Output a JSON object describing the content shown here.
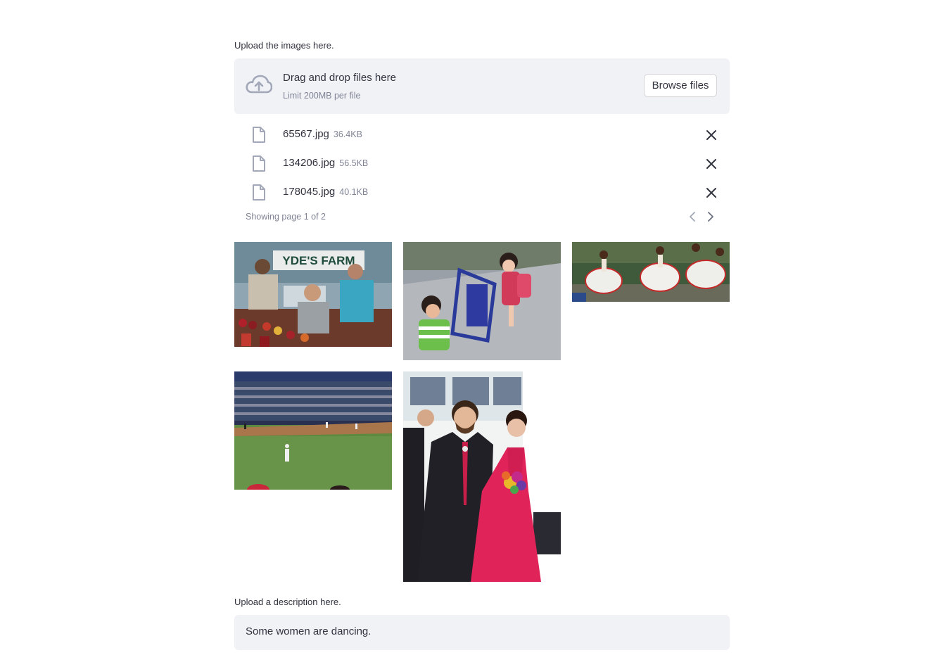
{
  "uploader": {
    "label": "Upload the images here.",
    "dropzone_title": "Drag and drop files here",
    "dropzone_limit": "Limit 200MB per file",
    "browse_label": "Browse files",
    "upload_icon": "cloud-upload-icon"
  },
  "files": [
    {
      "name": "65567.jpg",
      "size": "36.4KB"
    },
    {
      "name": "134206.jpg",
      "size": "56.5KB"
    },
    {
      "name": "178045.jpg",
      "size": "40.1KB"
    }
  ],
  "pager": {
    "text": "Showing page 1 of 2",
    "prev_icon": "chevron-left-icon",
    "next_icon": "chevron-right-icon"
  },
  "images": [
    {
      "subject": "farm market stand"
    },
    {
      "subject": "children with stroller"
    },
    {
      "subject": "dancers in white dresses"
    },
    {
      "subject": "baseball stadium"
    },
    {
      "subject": "wedding couple"
    }
  ],
  "description": {
    "label": "Upload a description here.",
    "value": "Some women are dancing."
  },
  "colors": {
    "panel_bg": "#f0f2f6",
    "text": "#31333f",
    "muted": "#808495",
    "icon": "#a3a8b8"
  }
}
